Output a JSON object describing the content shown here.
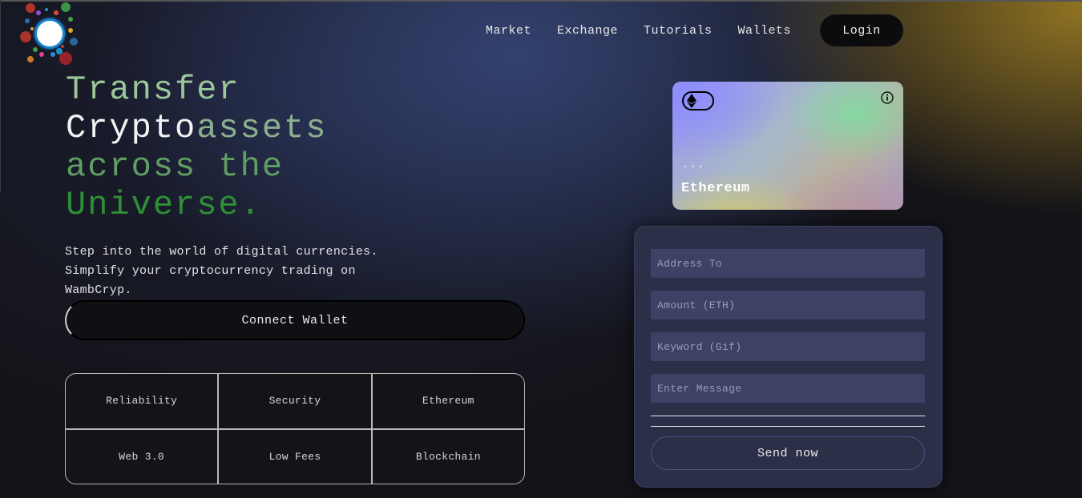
{
  "nav": {
    "items": [
      "Market",
      "Exchange",
      "Tutorials",
      "Wallets"
    ],
    "login_label": "Login"
  },
  "hero": {
    "line1": "Transfer",
    "line2a": "Crypto",
    "line2b": "assets",
    "line3": "across the",
    "line4": "Universe.",
    "subtitle": "Step into the world of digital currencies. Simplify your cryptocurrency trading on WambCryp.",
    "connect_label": "Connect Wallet"
  },
  "features": [
    "Reliability",
    "Security",
    "Ethereum",
    "Web 3.0",
    "Low Fees",
    "Blockchain"
  ],
  "card": {
    "address": "...",
    "network": "Ethereum"
  },
  "form": {
    "address_placeholder": "Address To",
    "amount_placeholder": "Amount (ETH)",
    "keyword_placeholder": "Keyword (Gif)",
    "message_placeholder": "Enter Message",
    "send_label": "Send now"
  },
  "icons": {
    "logo": "colorful-dot-ring-logo",
    "card_badge": "ethereum-icon",
    "card_info": "info-icon"
  }
}
